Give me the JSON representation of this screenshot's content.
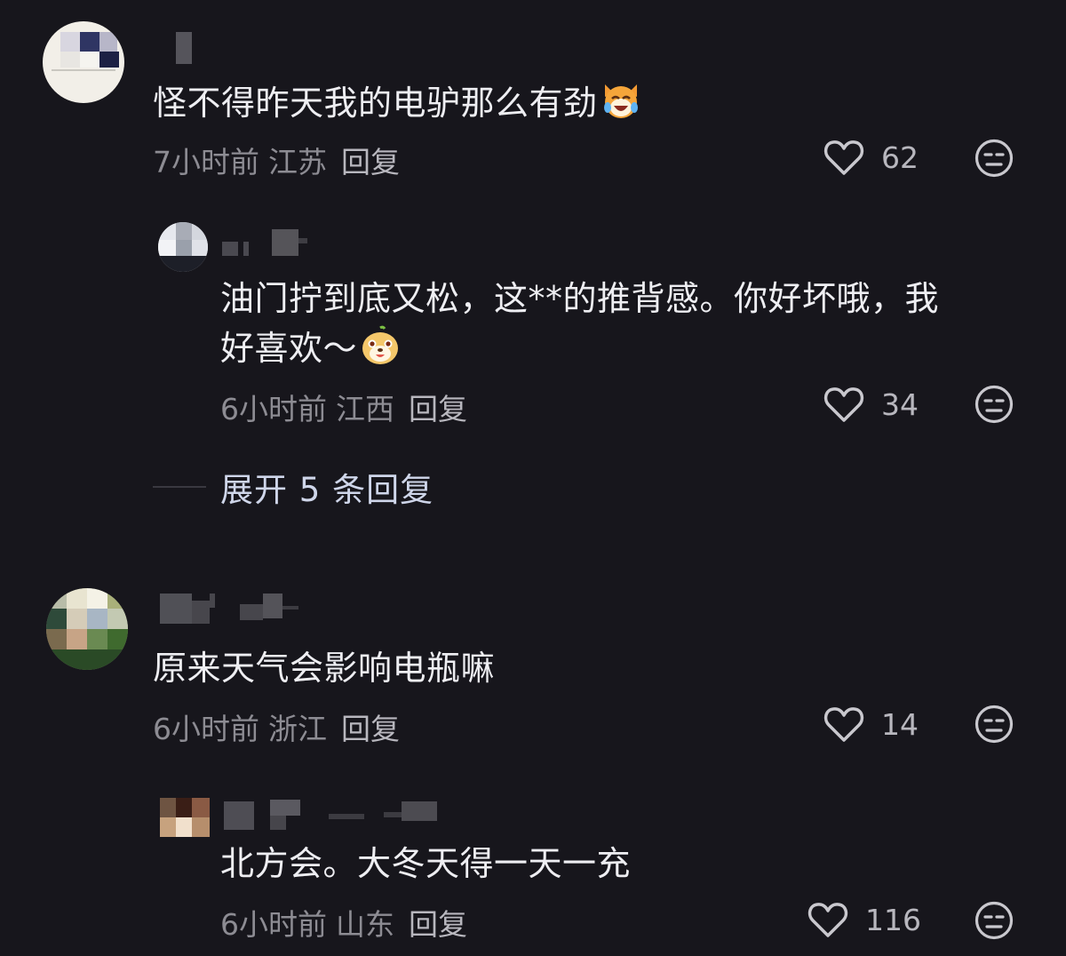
{
  "comments": [
    {
      "text": "怪不得昨天我的电驴那么有劲",
      "emoji": "laughing-cat-emoji",
      "time": "7小时前",
      "location": "江苏",
      "reply_label": "回复",
      "likes": "62"
    },
    {
      "text_line1": "油门拧到底又松，这**的推背感。你好坏哦，我",
      "text_line2": "好喜欢～",
      "emoji": "happy-dog-emoji",
      "time": "6小时前",
      "location": "江西",
      "reply_label": "回复",
      "likes": "34"
    },
    {
      "text": "原来天气会影响电瓶嘛",
      "time": "6小时前",
      "location": "浙江",
      "reply_label": "回复",
      "likes": "14"
    },
    {
      "text": "北方会。大冬天得一天一充",
      "time": "6小时前",
      "location": "山东",
      "reply_label": "回复",
      "likes": "116"
    }
  ],
  "expand_replies_label": "展开 5 条回复",
  "colors": {
    "background": "#17161c",
    "primary_text": "#eeeef2",
    "meta_text": "#8d8c93",
    "expand_text": "#cfd6ea"
  }
}
